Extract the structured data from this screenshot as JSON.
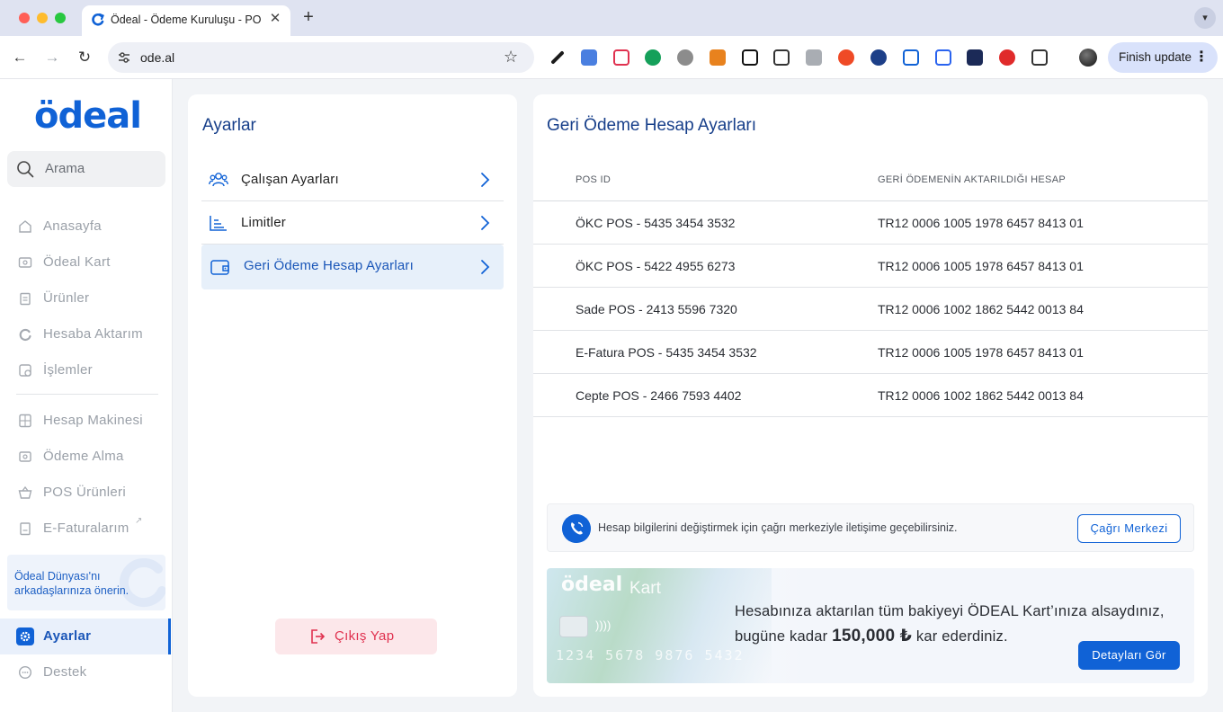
{
  "browser": {
    "tab_title": "Ödeal - Ödeme Kuruluşu - PO",
    "url": "ode.al",
    "finish_update_label": "Finish update"
  },
  "app": {
    "logo_text": "ödeal",
    "search_placeholder": "Arama",
    "nav": [
      {
        "label": "Anasayfa",
        "icon": "home-icon"
      },
      {
        "label": "Ödeal Kart",
        "icon": "card-icon"
      },
      {
        "label": "Ürünler",
        "icon": "clipboard-icon"
      },
      {
        "label": "Hesaba Aktarım",
        "icon": "transfer-icon"
      },
      {
        "label": "İşlemler",
        "icon": "transactions-icon"
      },
      {
        "label": "Hesap Makinesi",
        "icon": "calculator-icon"
      },
      {
        "label": "Ödeme Alma",
        "icon": "payment-icon"
      },
      {
        "label": "POS Ürünleri",
        "icon": "basket-icon"
      },
      {
        "label": "E-Faturalarım",
        "icon": "invoice-icon"
      }
    ],
    "promo_text": "Ödeal Dünyası'nı arkadaşlarınıza önerin.",
    "settings_nav_label": "Ayarlar",
    "support_nav_label": "Destek",
    "accent_color": "#1062d6"
  },
  "settings": {
    "title": "Ayarlar",
    "items": [
      {
        "label": "Çalışan Ayarları",
        "icon": "users-icon"
      },
      {
        "label": "Limitler",
        "icon": "chart-list-icon"
      },
      {
        "label": "Geri Ödeme Hesap Ayarları",
        "icon": "wallet-icon",
        "active": true
      }
    ],
    "logout_label": "Çıkış Yap"
  },
  "main": {
    "title": "Geri Ödeme Hesap Ayarları",
    "columns": [
      "POS ID",
      "GERİ ÖDEMENİN AKTARILDIĞI HESAP"
    ],
    "rows": [
      [
        "ÖKC POS - 5435 3454 3532",
        "TR12 0006 1005 1978 6457 8413 01"
      ],
      [
        "ÖKC POS - 5422 4955 6273",
        "TR12 0006 1005 1978 6457 8413 01"
      ],
      [
        "Sade POS - 2413 5596 7320",
        "TR12 0006 1002 1862 5442 0013 84"
      ],
      [
        "E-Fatura POS - 5435 3454 3532",
        "TR12 0006 1005 1978 6457 8413 01"
      ],
      [
        "Cepte POS - 2466 7593 4402",
        "TR12 0006 1002 1862 5442 0013 84"
      ]
    ],
    "info_text": "Hesap bilgilerini değiştirmek için çağrı merkeziyle iletişime geçebilirsiniz.",
    "info_button": "Çağrı Merkezi",
    "banner": {
      "card_logo": "ödeal",
      "card_kart": "Kart",
      "card_number": "1234 5678 9876 5432",
      "text_before": "Hesabınıza aktarılan tüm bakiyeyi ÖDEAL Kart’ınıza alsaydınız, bugüne kadar",
      "amount": "150,000 ₺",
      "text_after": "kar ederdiniz.",
      "button": "Detayları Gör"
    }
  }
}
